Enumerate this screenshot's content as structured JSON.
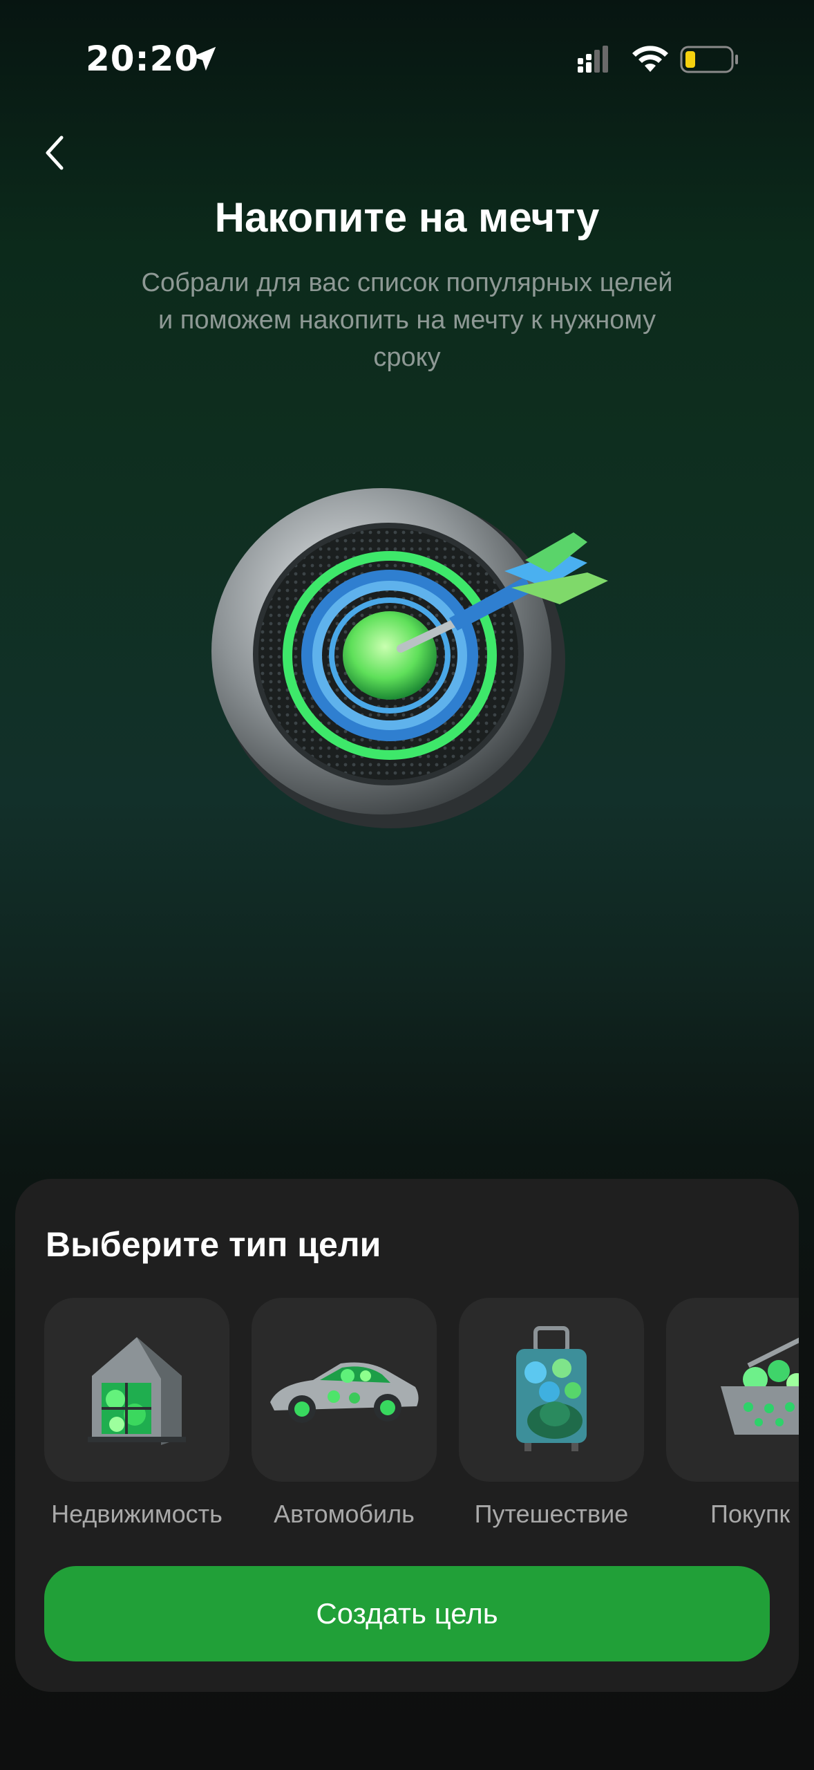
{
  "status_bar": {
    "time": "20:20",
    "icons": [
      "location-arrow-icon",
      "cellular-signal-icon",
      "wifi-icon",
      "battery-low-icon"
    ]
  },
  "header": {
    "back_icon": "chevron-left-icon",
    "title": "Накопите на мечту",
    "subtitle": "Собрали для вас список популярных целей и поможем накопить на мечту к нужному сроку"
  },
  "hero": {
    "icon": "dartboard-target-illustration"
  },
  "sheet": {
    "title": "Выберите тип цели",
    "goal_types": [
      {
        "label": "Недвижимость",
        "icon": "house-illustration"
      },
      {
        "label": "Автомобиль",
        "icon": "car-illustration"
      },
      {
        "label": "Путешествие",
        "icon": "suitcase-illustration"
      },
      {
        "label": "Покупк",
        "icon": "shopping-basket-illustration"
      }
    ],
    "create_button": "Создать цель"
  },
  "colors": {
    "accent": "#21a038",
    "sheet_bg": "#1f1f1f",
    "tile_bg": "#2a2a2a",
    "subtitle_text": "#8e9995",
    "label_text": "#a9a9a9",
    "battery_fill": "#f5d10f"
  }
}
